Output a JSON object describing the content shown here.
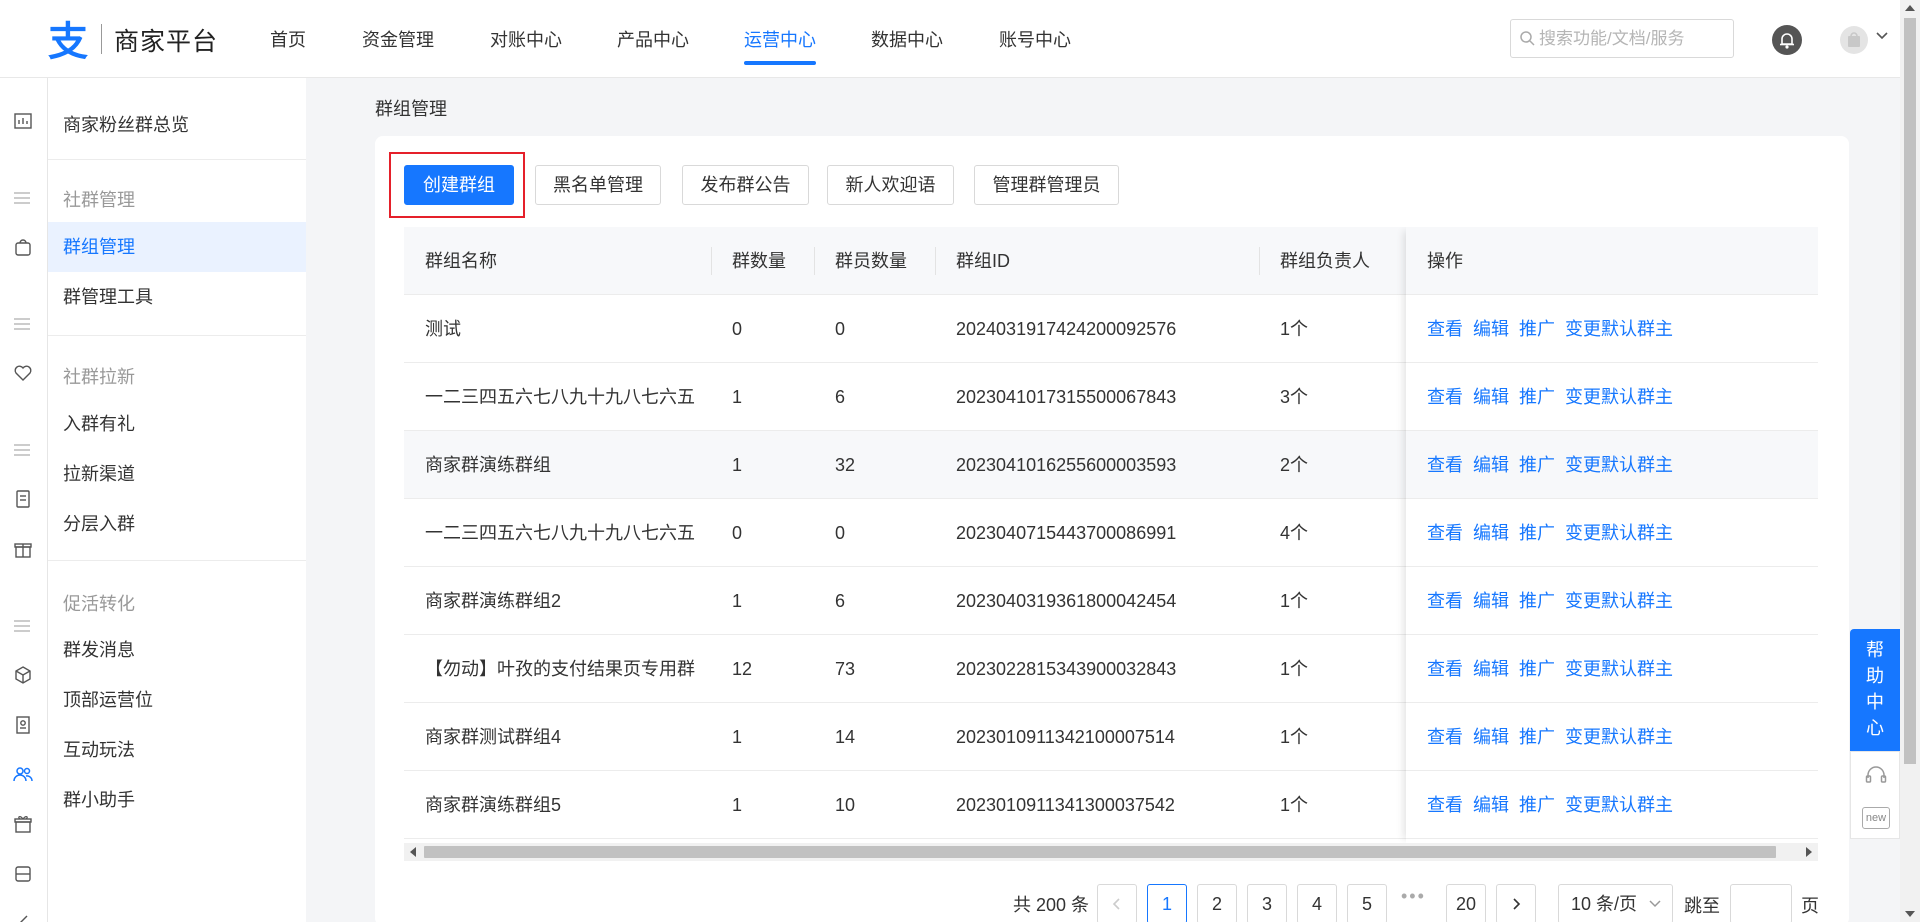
{
  "app": {
    "logo_text": "商家平台"
  },
  "nav": {
    "items": [
      "首页",
      "资金管理",
      "对账中心",
      "产品中心",
      "运营中心",
      "数据中心",
      "账号中心"
    ],
    "active": "运营中心"
  },
  "search": {
    "placeholder": "搜索功能/文档/服务"
  },
  "sidebar": {
    "overview": "商家粉丝群总览",
    "groups": [
      {
        "title": "社群管理",
        "items": [
          "群组管理",
          "群管理工具"
        ]
      },
      {
        "title": "社群拉新",
        "items": [
          "入群有礼",
          "拉新渠道",
          "分层入群"
        ]
      },
      {
        "title": "促活转化",
        "items": [
          "群发消息",
          "顶部运营位",
          "互动玩法",
          "群小助手"
        ]
      }
    ],
    "active": "群组管理"
  },
  "page": {
    "title": "群组管理"
  },
  "toolbar": {
    "create": "创建群组",
    "blacklist": "黑名单管理",
    "announce": "发布群公告",
    "welcome": "新人欢迎语",
    "admins": "管理群管理员"
  },
  "table": {
    "columns": [
      "群组名称",
      "群数量",
      "群员数量",
      "群组ID",
      "群组负责人",
      "操作"
    ],
    "rows": [
      [
        "测试",
        "0",
        "0",
        "2024031917424200092576",
        "1个"
      ],
      [
        "一二三四五六七八九十九八七六五",
        "1",
        "6",
        "2023041017315500067843",
        "3个"
      ],
      [
        "商家群演练群组",
        "1",
        "32",
        "2023041016255600003593",
        "2个"
      ],
      [
        "一二三四五六七八九十九八七六五",
        "0",
        "0",
        "2023040715443700086991",
        "4个"
      ],
      [
        "商家群演练群组2",
        "1",
        "6",
        "2023040319361800042454",
        "1个"
      ],
      [
        "【勿动】叶孜的支付结果页专用群",
        "12",
        "73",
        "2023022815343900032843",
        "1个"
      ],
      [
        "商家群测试群组4",
        "1",
        "14",
        "2023010911342100007514",
        "1个"
      ],
      [
        "商家群演练群组5",
        "1",
        "10",
        "2023010911341300037542",
        "1个"
      ]
    ],
    "actions": [
      "查看",
      "编辑",
      "推广",
      "变更默认群主"
    ]
  },
  "pagination": {
    "total": "共 200 条",
    "pages": [
      "1",
      "2",
      "3",
      "4",
      "5",
      "20"
    ],
    "current": "1",
    "ellipsis": "•••",
    "page_size": "10 条/页",
    "jump_label": "跳至",
    "page_unit": "页"
  },
  "help": {
    "label": [
      "帮",
      "助",
      "中",
      "心"
    ],
    "new_badge": "new"
  },
  "colors": {
    "accent": "#1677ff",
    "highlight": "#e5202a"
  }
}
